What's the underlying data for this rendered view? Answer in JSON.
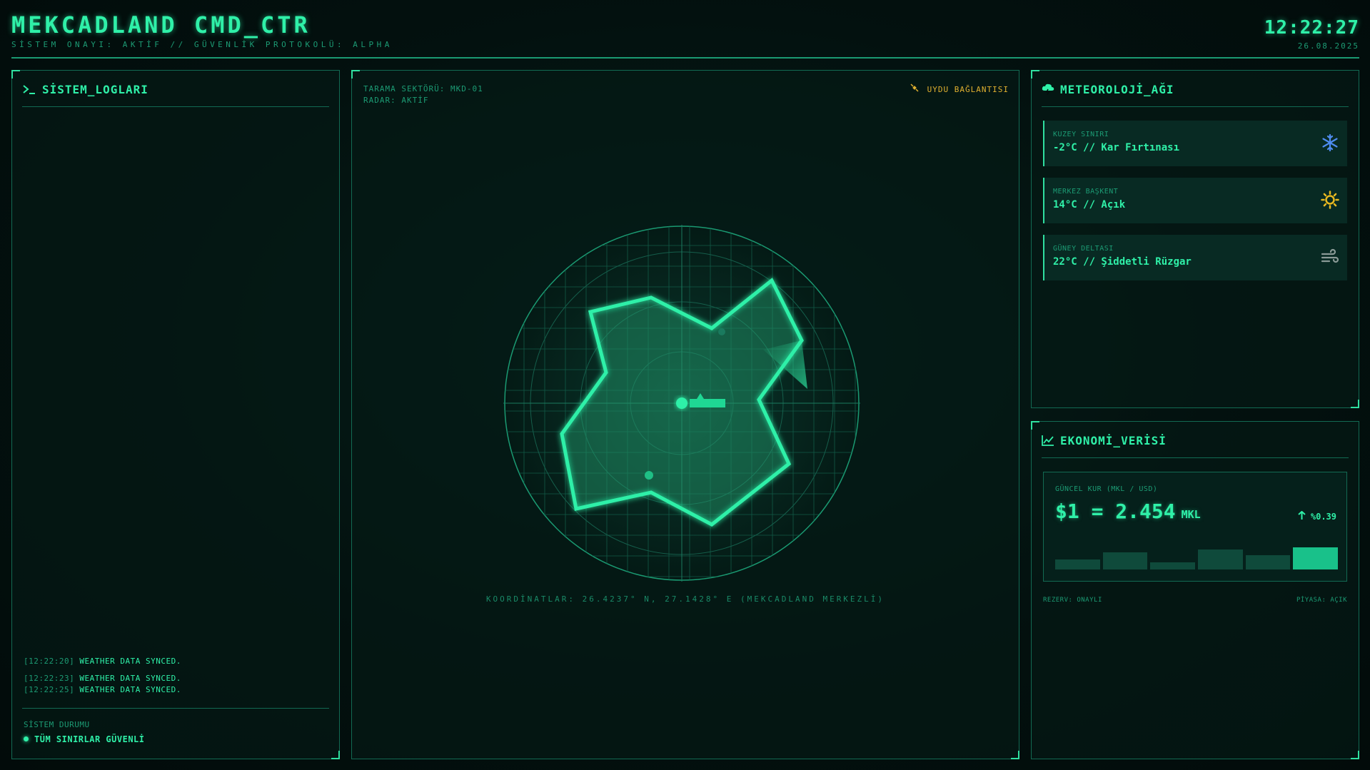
{
  "header": {
    "title": "MEKCADLAND CMD_CTR",
    "subtitle": "SİSTEM ONAYI: AKTİF // GÜVENLİK PROTOKOLÜ: ALPHA",
    "clock": "12:22:27",
    "date": "26.08.2025"
  },
  "logs_panel": {
    "title": "SİSTEM_LOGLARI",
    "entries": [
      {
        "time": "[12:22:20]",
        "message": "WEATHER DATA SYNCED."
      },
      {
        "time": "[12:22:23]",
        "message": "WEATHER DATA SYNCED."
      },
      {
        "time": "[12:22:25]",
        "message": "WEATHER DATA SYNCED."
      }
    ],
    "status_label": "SİSTEM DURUMU",
    "status_value": "TÜM SINIRLAR GÜVENLİ"
  },
  "radar_panel": {
    "sector": "TARAMA SEKTÖRÜ: MKD-01",
    "radar_status": "RADAR: AKTİF",
    "satellite": "UYDU BAĞLANTISI",
    "coordinates": "KOORDİNATLAR: 26.4237° N, 27.1428° E (MEKCADLAND MERKEZLİ)"
  },
  "weather_panel": {
    "title": "METEOROLOJİ_AĞI",
    "cards": [
      {
        "label": "KUZEY SINIRI",
        "value": "-2°C // Kar Fırtınası",
        "icon": "snowflake-icon",
        "icon_color": "#4f8cf0"
      },
      {
        "label": "MERKEZ BAŞKENT",
        "value": "14°C // Açık",
        "icon": "sun-icon",
        "icon_color": "#e8b820"
      },
      {
        "label": "GÜNEY DELTASI",
        "value": "22°C // Şiddetli Rüzgar",
        "icon": "wind-icon",
        "icon_color": "#8a9a96"
      }
    ]
  },
  "economy_panel": {
    "title": "EKONOMİ_VERİSİ",
    "rate_label": "GÜNCEL KUR (MKL / USD)",
    "rate_value": "$1 = 2.454",
    "rate_unit": "MKL",
    "rate_change": "%0.39",
    "trend": [
      0.35,
      0.6,
      0.25,
      0.7,
      0.5,
      0.78
    ],
    "reserve": "REZERV: ONAYLI",
    "market": "PİYASA: AÇIK"
  },
  "colors": {
    "accent": "#2ff0a8",
    "muted": "#1c9b74",
    "warning": "#e0b030"
  }
}
